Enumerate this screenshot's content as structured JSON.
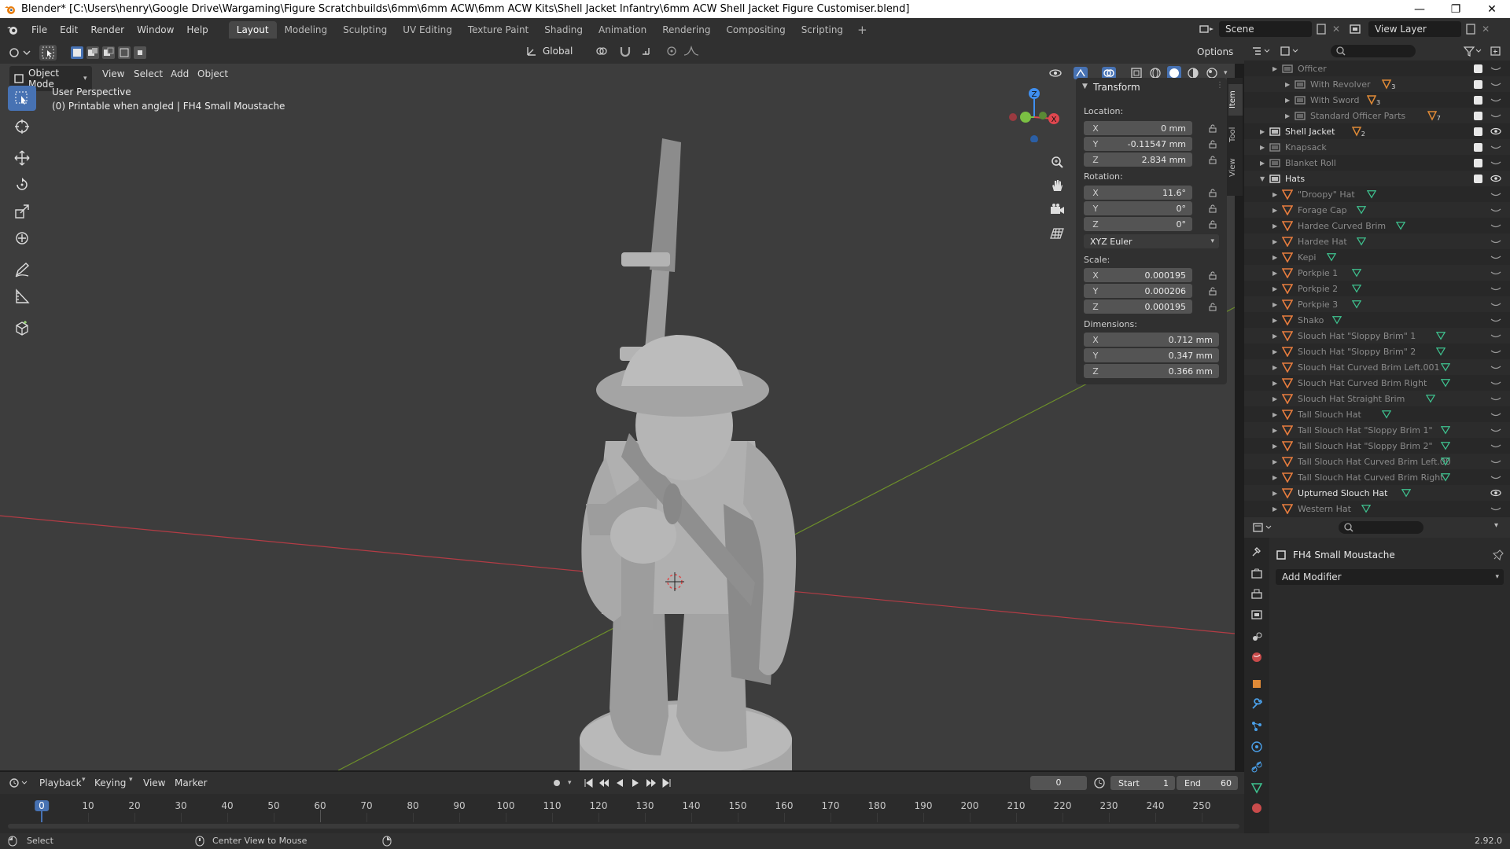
{
  "window": {
    "title": "Blender* [C:\\Users\\henry\\Google Drive\\Wargaming\\Figure Scratchbuilds\\6mm\\6mm ACW\\6mm ACW Kits\\Shell Jacket Infantry\\6mm ACW Shell Jacket Figure Customiser.blend]",
    "minimize": "—",
    "maximize": "❐",
    "close": "✕"
  },
  "menu": [
    "File",
    "Edit",
    "Render",
    "Window",
    "Help"
  ],
  "workspaces": [
    "Layout",
    "Modeling",
    "Sculpting",
    "UV Editing",
    "Texture Paint",
    "Shading",
    "Animation",
    "Rendering",
    "Compositing",
    "Scripting"
  ],
  "active_workspace": "Layout",
  "scene": {
    "name": "Scene",
    "view_layer": "View Layer"
  },
  "viewport_header": {
    "orientation": "Global",
    "options": "Options",
    "mode": "Object Mode",
    "menus": [
      "View",
      "Select",
      "Add",
      "Object"
    ]
  },
  "viewport": {
    "perspective": "User Perspective",
    "info": "(0) Printable when angled | FH4  Small Moustache",
    "gizmo": {
      "z": "Z",
      "y": "Y",
      "x": "X"
    }
  },
  "npanel": {
    "section": "Transform",
    "location_label": "Location:",
    "location": [
      {
        "axis": "X",
        "value": "0 mm"
      },
      {
        "axis": "Y",
        "value": "-0.11547 mm"
      },
      {
        "axis": "Z",
        "value": "2.834 mm"
      }
    ],
    "rotation_label": "Rotation:",
    "rotation": [
      {
        "axis": "X",
        "value": "11.6°"
      },
      {
        "axis": "Y",
        "value": "0°"
      },
      {
        "axis": "Z",
        "value": "0°"
      }
    ],
    "rotation_mode": "XYZ Euler",
    "scale_label": "Scale:",
    "scale": [
      {
        "axis": "X",
        "value": "0.000195"
      },
      {
        "axis": "Y",
        "value": "0.000206"
      },
      {
        "axis": "Z",
        "value": "0.000195"
      }
    ],
    "dimensions_label": "Dimensions:",
    "dimensions": [
      {
        "axis": "X",
        "value": "0.712 mm"
      },
      {
        "axis": "Y",
        "value": "0.347 mm"
      },
      {
        "axis": "Z",
        "value": "0.366 mm"
      }
    ],
    "tabs": [
      "Item",
      "Tool",
      "View"
    ]
  },
  "outliner": {
    "rows": [
      {
        "label": "Officer",
        "indent": 3,
        "type": "collection",
        "dim": true
      },
      {
        "label": "With Revolver",
        "indent": 4,
        "type": "collection",
        "dim": true,
        "badge": "3"
      },
      {
        "label": "With Sword",
        "indent": 4,
        "type": "collection",
        "dim": true,
        "badge": "3"
      },
      {
        "label": "Standard Officer Parts",
        "indent": 4,
        "type": "collection",
        "dim": true,
        "badge": "7"
      },
      {
        "label": "Shell Jacket",
        "indent": 2,
        "type": "collection",
        "dim": false,
        "badge": "2"
      },
      {
        "label": "Knapsack",
        "indent": 2,
        "type": "collection",
        "dim": true
      },
      {
        "label": "Blanket Roll",
        "indent": 2,
        "type": "collection",
        "dim": true
      },
      {
        "label": "Hats",
        "indent": 2,
        "type": "collection",
        "dim": false,
        "open": true
      },
      {
        "label": "\"Droopy\" Hat",
        "indent": 3,
        "type": "mesh",
        "dim": true
      },
      {
        "label": "Forage Cap",
        "indent": 3,
        "type": "mesh",
        "dim": true
      },
      {
        "label": "Hardee Curved Brim",
        "indent": 3,
        "type": "mesh",
        "dim": true
      },
      {
        "label": "Hardee Hat",
        "indent": 3,
        "type": "mesh",
        "dim": true
      },
      {
        "label": "Kepi",
        "indent": 3,
        "type": "mesh",
        "dim": true
      },
      {
        "label": "Porkpie 1",
        "indent": 3,
        "type": "mesh",
        "dim": true
      },
      {
        "label": "Porkpie 2",
        "indent": 3,
        "type": "mesh",
        "dim": true
      },
      {
        "label": "Porkpie 3",
        "indent": 3,
        "type": "mesh",
        "dim": true
      },
      {
        "label": "Shako",
        "indent": 3,
        "type": "mesh",
        "dim": true
      },
      {
        "label": "Slouch Hat \"Sloppy Brim\" 1",
        "indent": 3,
        "type": "mesh",
        "dim": true
      },
      {
        "label": "Slouch Hat \"Sloppy Brim\" 2",
        "indent": 3,
        "type": "mesh",
        "dim": true
      },
      {
        "label": "Slouch Hat Curved Brim Left.001",
        "indent": 3,
        "type": "mesh",
        "dim": true
      },
      {
        "label": "Slouch Hat Curved Brim Right",
        "indent": 3,
        "type": "mesh",
        "dim": true
      },
      {
        "label": "Slouch Hat Straight Brim",
        "indent": 3,
        "type": "mesh",
        "dim": true
      },
      {
        "label": "Tall Slouch Hat",
        "indent": 3,
        "type": "mesh",
        "dim": true
      },
      {
        "label": "Tall Slouch Hat \"Sloppy Brim 1\"",
        "indent": 3,
        "type": "mesh",
        "dim": true
      },
      {
        "label": "Tall Slouch Hat \"Sloppy Brim 2\"",
        "indent": 3,
        "type": "mesh",
        "dim": true
      },
      {
        "label": "Tall Slouch Hat Curved Brim Left.00",
        "indent": 3,
        "type": "mesh",
        "dim": true
      },
      {
        "label": "Tall Slouch Hat Curved Brim Right",
        "indent": 3,
        "type": "mesh",
        "dim": true
      },
      {
        "label": "Upturned Slouch Hat",
        "indent": 3,
        "type": "mesh",
        "dim": false,
        "visible": true
      },
      {
        "label": "Western Hat",
        "indent": 3,
        "type": "mesh",
        "dim": true
      }
    ]
  },
  "properties": {
    "object_name": "FH4  Small Moustache",
    "add_modifier": "Add Modifier"
  },
  "timeline": {
    "menus": [
      "Playback",
      "Keying",
      "View",
      "Marker"
    ],
    "current_frame": "0",
    "start_label": "Start",
    "start": "1",
    "end_label": "End",
    "end": "60",
    "ticks": [
      "0",
      "10",
      "20",
      "30",
      "40",
      "50",
      "60",
      "70",
      "80",
      "90",
      "100",
      "110",
      "120",
      "130",
      "140",
      "150",
      "160",
      "170",
      "180",
      "190",
      "200",
      "210",
      "220",
      "230",
      "240",
      "250"
    ]
  },
  "status": {
    "left": "Select",
    "middle": "Center View to Mouse",
    "version": "2.92.0"
  },
  "colors": {
    "accent": "#4772b3",
    "mesh_icon": "#e87d3e",
    "orange_icon": "#e08a37",
    "vertex_group": "#3ec28f",
    "x_axis": "#e0474f",
    "y_axis": "#7bc043",
    "z_axis": "#3f8ff0"
  }
}
